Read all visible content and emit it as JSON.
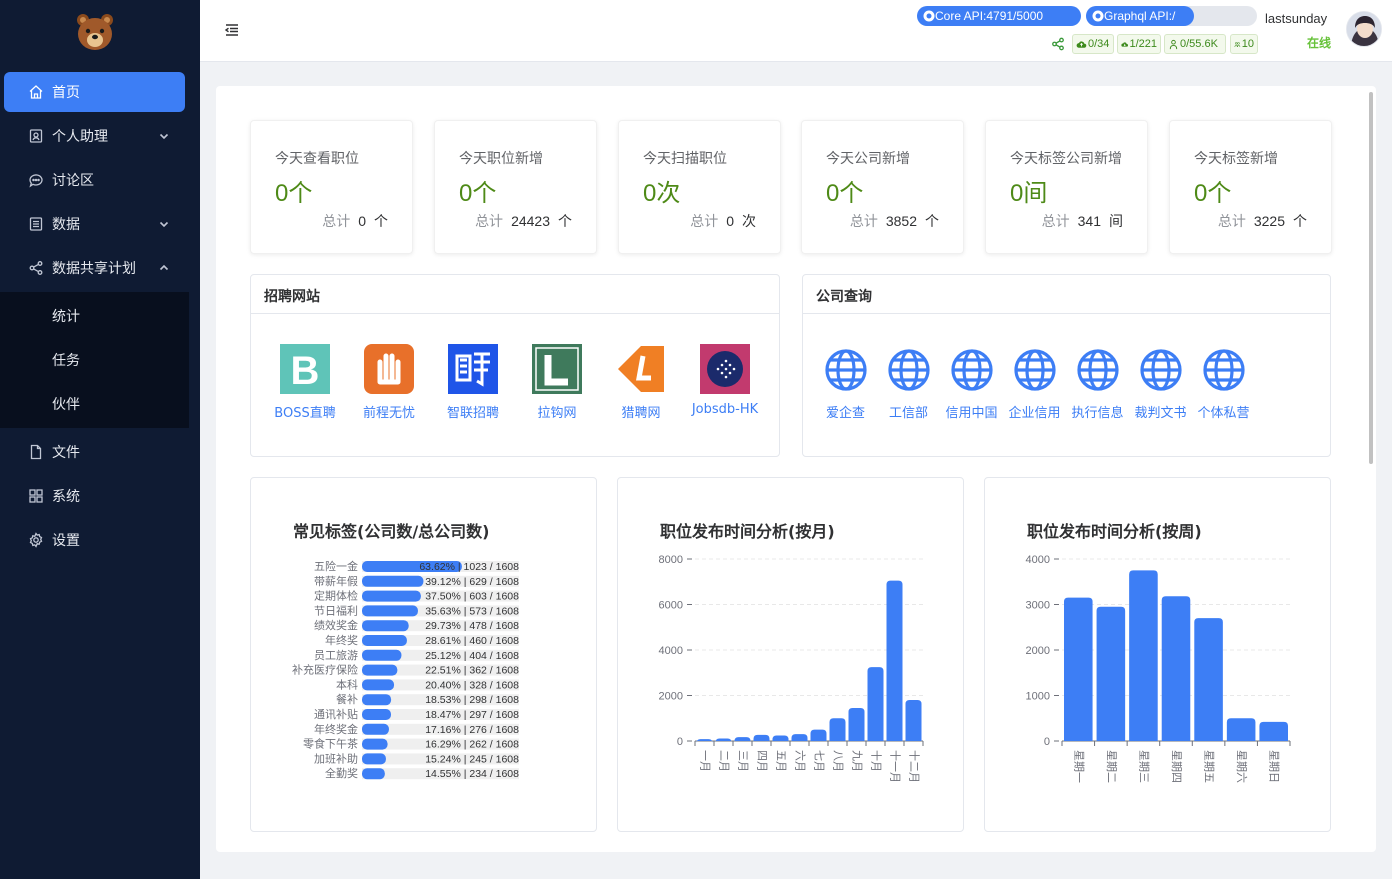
{
  "sidebar": {
    "items": [
      {
        "label": "首页",
        "icon": "home-icon"
      },
      {
        "label": "个人助理",
        "icon": "assistant-icon"
      },
      {
        "label": "讨论区",
        "icon": "chat-icon"
      },
      {
        "label": "数据",
        "icon": "data-icon"
      },
      {
        "label": "数据共享计划",
        "icon": "share-icon"
      },
      {
        "label": "文件",
        "icon": "file-icon"
      },
      {
        "label": "系统",
        "icon": "grid-icon"
      },
      {
        "label": "设置",
        "icon": "gear-icon"
      }
    ],
    "sub_items": [
      "统计",
      "任务",
      "伙伴"
    ]
  },
  "header": {
    "core_api": "Core API:4791/5000",
    "core_api_progress": 0.9582,
    "graphql_api": "Graphql API:/",
    "username": "lastsunday",
    "status": "在线",
    "tags": [
      "0/34",
      "1/221",
      "0/55.6K",
      "10"
    ]
  },
  "stats": [
    {
      "title": "今天查看职位",
      "value": "0个",
      "total_label": "总计",
      "total": "0",
      "unit": "个"
    },
    {
      "title": "今天职位新增",
      "value": "0个",
      "total_label": "总计",
      "total": "24423",
      "unit": "个"
    },
    {
      "title": "今天扫描职位",
      "value": "0次",
      "total_label": "总计",
      "total": "0",
      "unit": "次"
    },
    {
      "title": "今天公司新增",
      "value": "0个",
      "total_label": "总计",
      "total": "3852",
      "unit": "个"
    },
    {
      "title": "今天标签公司新增",
      "value": "0间",
      "total_label": "总计",
      "total": "341",
      "unit": "间"
    },
    {
      "title": "今天标签新增",
      "value": "0个",
      "total_label": "总计",
      "total": "3225",
      "unit": "个"
    }
  ],
  "recruit_panel": {
    "title": "招聘网站",
    "sites": [
      "BOSS直聘",
      "前程无忧",
      "智联招聘",
      "拉钩网",
      "猎聘网",
      "Jobsdb-HK"
    ]
  },
  "company_panel": {
    "title": "公司查询",
    "links": [
      "爱企查",
      "工信部",
      "信用中国",
      "企业信用",
      "执行信息",
      "裁判文书",
      "个体私营"
    ]
  },
  "colors": {
    "accent": "#3d7ef5",
    "success": "#4e8a17",
    "sidebar": "#0f1b33"
  },
  "chart_data": [
    {
      "type": "bar",
      "orientation": "horizontal",
      "title": "常见标签(公司数/总公司数)",
      "categories": [
        "五险一金",
        "带薪年假",
        "定期体检",
        "节日福利",
        "绩效奖金",
        "年终奖",
        "员工旅游",
        "补充医疗保险",
        "本科",
        "餐补",
        "通讯补贴",
        "年终奖金",
        "零食下午茶",
        "加班补助",
        "全勤奖"
      ],
      "labels": [
        "63.62% | 1023 / 1608",
        "39.12% | 629 / 1608",
        "37.50% | 603 / 1608",
        "35.63% | 573 / 1608",
        "29.73% | 478 / 1608",
        "28.61% | 460 / 1608",
        "25.12% | 404 / 1608",
        "22.51% | 362 / 1608",
        "20.40% | 328 / 1608",
        "18.53% | 298 / 1608",
        "18.47% | 297 / 1608",
        "17.16% | 276 / 1608",
        "16.29% | 262 / 1608",
        "15.24% | 245 / 1608",
        "14.55% | 234 / 1608"
      ],
      "values": [
        63.62,
        39.12,
        37.5,
        35.63,
        29.73,
        28.61,
        25.12,
        22.51,
        20.4,
        18.53,
        18.47,
        17.16,
        16.29,
        15.24,
        14.55
      ],
      "xlim": [
        0,
        100
      ]
    },
    {
      "type": "bar",
      "title": "职位发布时间分析(按月)",
      "categories": [
        "一月",
        "二月",
        "三月",
        "四月",
        "五月",
        "六月",
        "七月",
        "八月",
        "九月",
        "十月",
        "十一月",
        "十二月"
      ],
      "values": [
        80,
        110,
        170,
        270,
        240,
        300,
        500,
        1000,
        1450,
        3250,
        7050,
        1800
      ],
      "ylim": [
        0,
        8000
      ],
      "yticks": [
        0,
        2000,
        4000,
        6000,
        8000
      ],
      "grid": true
    },
    {
      "type": "bar",
      "title": "职位发布时间分析(按周)",
      "categories": [
        "星期一",
        "星期二",
        "星期三",
        "星期四",
        "星期五",
        "星期六",
        "星期日"
      ],
      "values": [
        3150,
        2950,
        3750,
        3180,
        2700,
        500,
        420
      ],
      "ylim": [
        0,
        4000
      ],
      "yticks": [
        0,
        1000,
        2000,
        3000,
        4000
      ],
      "grid": true
    }
  ]
}
